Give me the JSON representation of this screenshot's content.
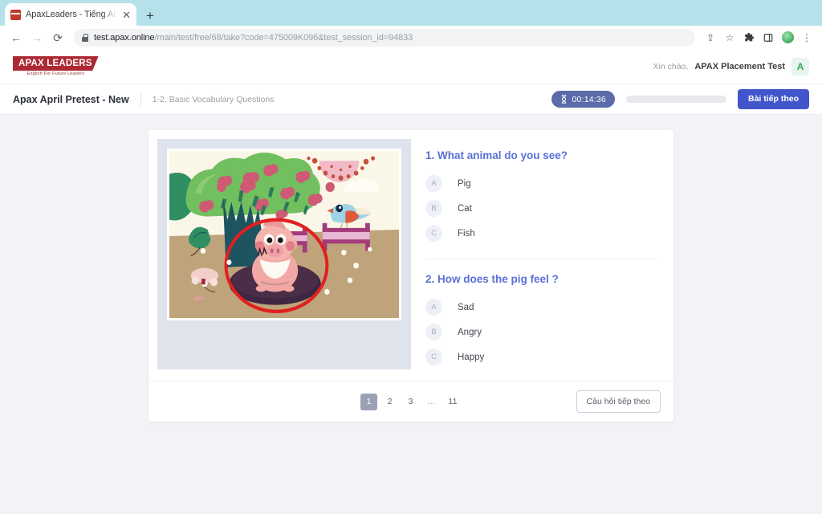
{
  "browser": {
    "tab": {
      "title": "ApaxLeaders - Tiếng Anh trẻ e",
      "close_label": "✕",
      "favicon_name": "apax-favicon"
    },
    "new_tab_label": "+",
    "nav": {
      "back": "←",
      "forward": "→",
      "reload": "⟳"
    },
    "omnibox": {
      "domain": "test.apax.online",
      "path": "/main/test/free/68/take?code=475009K096&test_session_id=94833",
      "lock_icon": "lock-icon"
    },
    "toolbar_icons": [
      "share-icon",
      "bookmark-star-icon",
      "extensions-puzzle-icon",
      "side-panel-icon",
      "profile-avatar-icon",
      "chrome-menu-icon"
    ],
    "share_glyph": "⇪",
    "star_glyph": "☆",
    "menu_glyph": "⋮",
    "chevron_glyph": "⌄"
  },
  "header": {
    "logo_text": "APAX LEADERS",
    "logo_tagline": "English For Future Leaders",
    "greeting": "Xin chào,",
    "user_name": "APAX Placement Test",
    "avatar_initial": "A"
  },
  "subheader": {
    "test_title": "Apax April Pretest - New",
    "section_title": "1-2. Basic Vocabulary Questions",
    "timer_value": "00:14:36",
    "timer_icon": "hourglass-icon",
    "progress_percent": 0,
    "next_lesson_button": "Bài tiếp theo"
  },
  "main": {
    "image_alt": "pig-in-mud-illustration",
    "questions": [
      {
        "number": "1.",
        "text": "What animal do you see?",
        "title": "1. What animal do you see?",
        "options": [
          {
            "letter": "A",
            "text": "Pig"
          },
          {
            "letter": "B",
            "text": "Cat"
          },
          {
            "letter": "C",
            "text": "Fish"
          }
        ]
      },
      {
        "number": "2.",
        "text": "How does the pig feel ?",
        "title": "2. How does the pig feel ?",
        "options": [
          {
            "letter": "A",
            "text": "Sad"
          },
          {
            "letter": "B",
            "text": "Angry"
          },
          {
            "letter": "C",
            "text": "Happy"
          }
        ]
      }
    ],
    "pagination": {
      "pages": [
        "1",
        "2",
        "3",
        "…",
        "11"
      ],
      "active": "1"
    },
    "next_question_button": "Câu hỏi tiếp theo"
  },
  "colors": {
    "accent_blue": "#4256cc",
    "question_blue": "#5b6fd6",
    "timer_bg": "#5b6aa8",
    "logo_red": "#ad2934",
    "avatar_green": "#34a853",
    "page_bg": "#f1f3f6",
    "image_panel_bg": "#dfe3ec"
  }
}
